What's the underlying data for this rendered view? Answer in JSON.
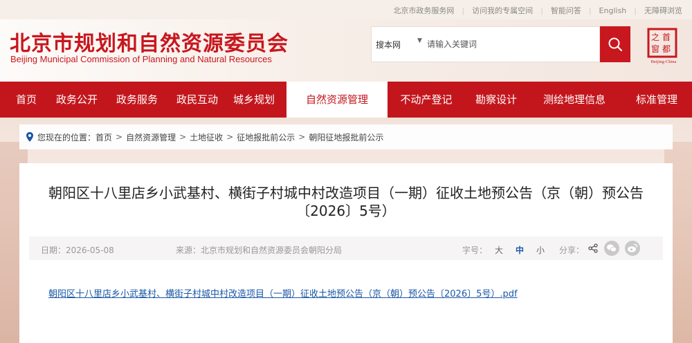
{
  "topbar": {
    "links": [
      "北京市政务服务网",
      "访问我的专属空间",
      "智能问答",
      "English",
      "无障碍浏览"
    ]
  },
  "header": {
    "title_cn": "北京市规划和自然资源委员会",
    "title_en": "Beijing Municipal Commission of Planning and Natural Resources",
    "search_scope": "搜本网",
    "search_placeholder": "请输入关键词",
    "seal_lines": [
      "首",
      "都",
      "之",
      "窗"
    ],
    "seal_caption": "Beijing-China"
  },
  "nav": {
    "items": [
      "首页",
      "政务公开",
      "政务服务",
      "政民互动",
      "城乡规划",
      "自然资源管理",
      "不动产登记",
      "勘察设计",
      "测绘地理信息",
      "标准管理"
    ],
    "active_index": 5
  },
  "breadcrumb": {
    "prefix": "您现在的位置：",
    "items": [
      "首页",
      "自然资源管理",
      "土地征收",
      "征地报批前公示",
      "朝阳征地报批前公示"
    ]
  },
  "article": {
    "title": "朝阳区十八里店乡小武基村、横街子村城中村改造项目（一期）征收土地预公告（京（朝）预公告〔2026〕5号）",
    "date": "日期：2026-05-08",
    "source": "来源：北京市规划和自然资源委员会朝阳分局",
    "font_size_label": "字号：",
    "font_sizes": [
      "大",
      "中",
      "小"
    ],
    "font_size_selected": "中",
    "share_label": "分享：",
    "share_icons": [
      "share-icon",
      "wechat-icon",
      "weibo-icon"
    ],
    "attachment": "朝阳区十八里店乡小武基村、横街子村城中村改造项目（一期）征收土地预公告（京（朝）预公告〔2026〕5号）.pdf"
  },
  "colors": {
    "brand_red": "#c3161c",
    "link_blue": "#1a57a6"
  }
}
